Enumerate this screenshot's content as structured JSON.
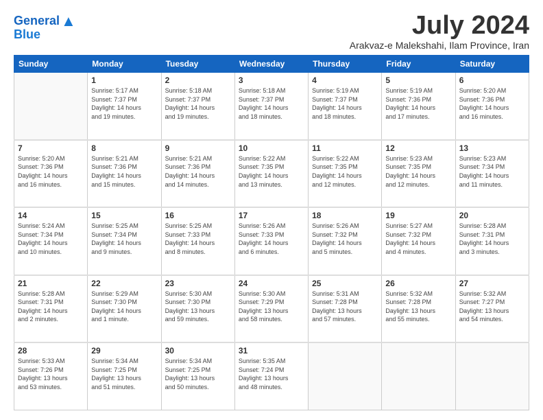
{
  "header": {
    "logo_line1": "General",
    "logo_line2": "Blue",
    "month": "July 2024",
    "location": "Arakvaz-e Malekshahi, Ilam Province, Iran"
  },
  "days_of_week": [
    "Sunday",
    "Monday",
    "Tuesday",
    "Wednesday",
    "Thursday",
    "Friday",
    "Saturday"
  ],
  "weeks": [
    [
      {
        "day": "",
        "info": ""
      },
      {
        "day": "1",
        "info": "Sunrise: 5:17 AM\nSunset: 7:37 PM\nDaylight: 14 hours\nand 19 minutes."
      },
      {
        "day": "2",
        "info": "Sunrise: 5:18 AM\nSunset: 7:37 PM\nDaylight: 14 hours\nand 19 minutes."
      },
      {
        "day": "3",
        "info": "Sunrise: 5:18 AM\nSunset: 7:37 PM\nDaylight: 14 hours\nand 18 minutes."
      },
      {
        "day": "4",
        "info": "Sunrise: 5:19 AM\nSunset: 7:37 PM\nDaylight: 14 hours\nand 18 minutes."
      },
      {
        "day": "5",
        "info": "Sunrise: 5:19 AM\nSunset: 7:36 PM\nDaylight: 14 hours\nand 17 minutes."
      },
      {
        "day": "6",
        "info": "Sunrise: 5:20 AM\nSunset: 7:36 PM\nDaylight: 14 hours\nand 16 minutes."
      }
    ],
    [
      {
        "day": "7",
        "info": "Sunrise: 5:20 AM\nSunset: 7:36 PM\nDaylight: 14 hours\nand 16 minutes."
      },
      {
        "day": "8",
        "info": "Sunrise: 5:21 AM\nSunset: 7:36 PM\nDaylight: 14 hours\nand 15 minutes."
      },
      {
        "day": "9",
        "info": "Sunrise: 5:21 AM\nSunset: 7:36 PM\nDaylight: 14 hours\nand 14 minutes."
      },
      {
        "day": "10",
        "info": "Sunrise: 5:22 AM\nSunset: 7:35 PM\nDaylight: 14 hours\nand 13 minutes."
      },
      {
        "day": "11",
        "info": "Sunrise: 5:22 AM\nSunset: 7:35 PM\nDaylight: 14 hours\nand 12 minutes."
      },
      {
        "day": "12",
        "info": "Sunrise: 5:23 AM\nSunset: 7:35 PM\nDaylight: 14 hours\nand 12 minutes."
      },
      {
        "day": "13",
        "info": "Sunrise: 5:23 AM\nSunset: 7:34 PM\nDaylight: 14 hours\nand 11 minutes."
      }
    ],
    [
      {
        "day": "14",
        "info": "Sunrise: 5:24 AM\nSunset: 7:34 PM\nDaylight: 14 hours\nand 10 minutes."
      },
      {
        "day": "15",
        "info": "Sunrise: 5:25 AM\nSunset: 7:34 PM\nDaylight: 14 hours\nand 9 minutes."
      },
      {
        "day": "16",
        "info": "Sunrise: 5:25 AM\nSunset: 7:33 PM\nDaylight: 14 hours\nand 8 minutes."
      },
      {
        "day": "17",
        "info": "Sunrise: 5:26 AM\nSunset: 7:33 PM\nDaylight: 14 hours\nand 6 minutes."
      },
      {
        "day": "18",
        "info": "Sunrise: 5:26 AM\nSunset: 7:32 PM\nDaylight: 14 hours\nand 5 minutes."
      },
      {
        "day": "19",
        "info": "Sunrise: 5:27 AM\nSunset: 7:32 PM\nDaylight: 14 hours\nand 4 minutes."
      },
      {
        "day": "20",
        "info": "Sunrise: 5:28 AM\nSunset: 7:31 PM\nDaylight: 14 hours\nand 3 minutes."
      }
    ],
    [
      {
        "day": "21",
        "info": "Sunrise: 5:28 AM\nSunset: 7:31 PM\nDaylight: 14 hours\nand 2 minutes."
      },
      {
        "day": "22",
        "info": "Sunrise: 5:29 AM\nSunset: 7:30 PM\nDaylight: 14 hours\nand 1 minute."
      },
      {
        "day": "23",
        "info": "Sunrise: 5:30 AM\nSunset: 7:30 PM\nDaylight: 13 hours\nand 59 minutes."
      },
      {
        "day": "24",
        "info": "Sunrise: 5:30 AM\nSunset: 7:29 PM\nDaylight: 13 hours\nand 58 minutes."
      },
      {
        "day": "25",
        "info": "Sunrise: 5:31 AM\nSunset: 7:28 PM\nDaylight: 13 hours\nand 57 minutes."
      },
      {
        "day": "26",
        "info": "Sunrise: 5:32 AM\nSunset: 7:28 PM\nDaylight: 13 hours\nand 55 minutes."
      },
      {
        "day": "27",
        "info": "Sunrise: 5:32 AM\nSunset: 7:27 PM\nDaylight: 13 hours\nand 54 minutes."
      }
    ],
    [
      {
        "day": "28",
        "info": "Sunrise: 5:33 AM\nSunset: 7:26 PM\nDaylight: 13 hours\nand 53 minutes."
      },
      {
        "day": "29",
        "info": "Sunrise: 5:34 AM\nSunset: 7:25 PM\nDaylight: 13 hours\nand 51 minutes."
      },
      {
        "day": "30",
        "info": "Sunrise: 5:34 AM\nSunset: 7:25 PM\nDaylight: 13 hours\nand 50 minutes."
      },
      {
        "day": "31",
        "info": "Sunrise: 5:35 AM\nSunset: 7:24 PM\nDaylight: 13 hours\nand 48 minutes."
      },
      {
        "day": "",
        "info": ""
      },
      {
        "day": "",
        "info": ""
      },
      {
        "day": "",
        "info": ""
      }
    ]
  ]
}
